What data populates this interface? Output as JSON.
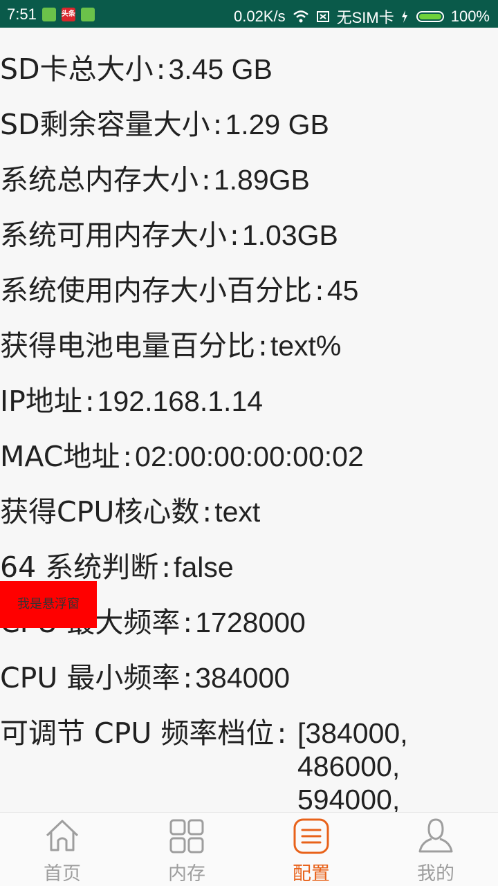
{
  "status_bar": {
    "time": "7:51",
    "app_icon_2_text": "头条",
    "net_speed": "0.02K/s",
    "sim": "无SIM卡",
    "battery": "100%"
  },
  "info": {
    "separator": ":",
    "rows": [
      {
        "label": "SD卡总大小",
        "value": "3.45 GB"
      },
      {
        "label": "SD剩余容量大小",
        "value": "1.29 GB"
      },
      {
        "label": "系统总内存大小",
        "value": "1.89GB"
      },
      {
        "label": "系统可用内存大小",
        "value": "1.03GB"
      },
      {
        "label": "系统使用内存大小百分比",
        "value": "45"
      },
      {
        "label": "获得电池电量百分比",
        "value": "text%"
      },
      {
        "label": "IP地址",
        "value": "192.168.1.14"
      },
      {
        "label": "MAC地址",
        "value": "02:00:00:00:00:02"
      },
      {
        "label": "获得CPU核心数",
        "value": "text"
      },
      {
        "label": "64 系统判断",
        "value": "false"
      },
      {
        "label": "CPU 最大频率",
        "value": "1728000"
      },
      {
        "label": "CPU 最小频率",
        "value": "384000"
      }
    ],
    "cpu_steps": {
      "label": "可调节 CPU 频率档位",
      "values": [
        "[384000,",
        "486000,",
        "594000,"
      ]
    }
  },
  "float_window": {
    "text": "我是悬浮窗"
  },
  "tabs": [
    {
      "label": "首页",
      "icon": "home-icon",
      "active": false
    },
    {
      "label": "内存",
      "icon": "grid-icon",
      "active": false
    },
    {
      "label": "配置",
      "icon": "list-icon",
      "active": true
    },
    {
      "label": "我的",
      "icon": "user-icon",
      "active": false
    }
  ],
  "colors": {
    "status_bar": "#0a5a4a",
    "accent": "#e8621a",
    "tab_inactive": "#9e9e9e",
    "float_window": "#ff0000"
  }
}
